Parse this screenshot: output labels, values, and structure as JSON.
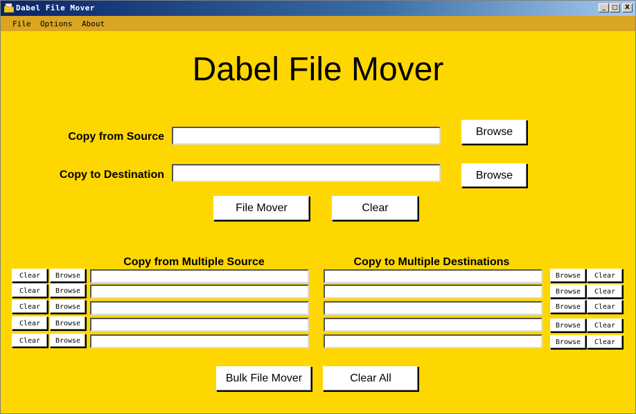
{
  "window": {
    "title": "Dabel File Mover",
    "controls": {
      "minimize": "_",
      "maximize": "□",
      "close": "X"
    }
  },
  "menu": {
    "items": [
      "File",
      "Options",
      "About"
    ]
  },
  "app": {
    "heading": "Dabel File Mover",
    "single": {
      "source_label": "Copy from Source",
      "source_value": "",
      "destination_label": "Copy to Destination",
      "destination_value": "",
      "browse_source": "Browse",
      "browse_destination": "Browse",
      "file_mover": "File Mover",
      "clear": "Clear"
    },
    "multi": {
      "source_heading": "Copy from Multiple Source",
      "destination_heading": "Copy to Multiple Destinations",
      "clear_label": "Clear",
      "browse_label": "Browse",
      "sources": [
        "",
        "",
        "",
        "",
        ""
      ],
      "destinations": [
        "",
        "",
        "",
        "",
        ""
      ]
    },
    "bulk_file_mover": "Bulk File Mover",
    "clear_all": "Clear All"
  },
  "colors": {
    "background": "#ffd700",
    "menubar": "#daa520",
    "titlebar": "#0a246a"
  }
}
